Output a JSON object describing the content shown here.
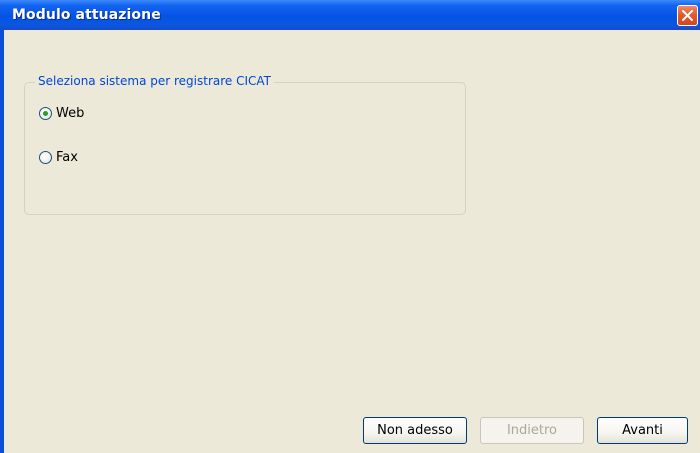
{
  "window": {
    "title": "Modulo attuazione",
    "title_bar_color": "#0553e4",
    "client_bg_color": "#ece9d8"
  },
  "icons": {
    "close": "close-icon"
  },
  "group": {
    "caption": "Seleziona sistema per registrare CICAT",
    "options": [
      {
        "label": "Web",
        "selected": true
      },
      {
        "label": "Fax",
        "selected": false
      }
    ]
  },
  "buttons": {
    "not_now": {
      "label": "Non adesso",
      "enabled": true
    },
    "back": {
      "label": "Indietro",
      "enabled": false
    },
    "next": {
      "label": "Avanti",
      "enabled": true
    }
  }
}
